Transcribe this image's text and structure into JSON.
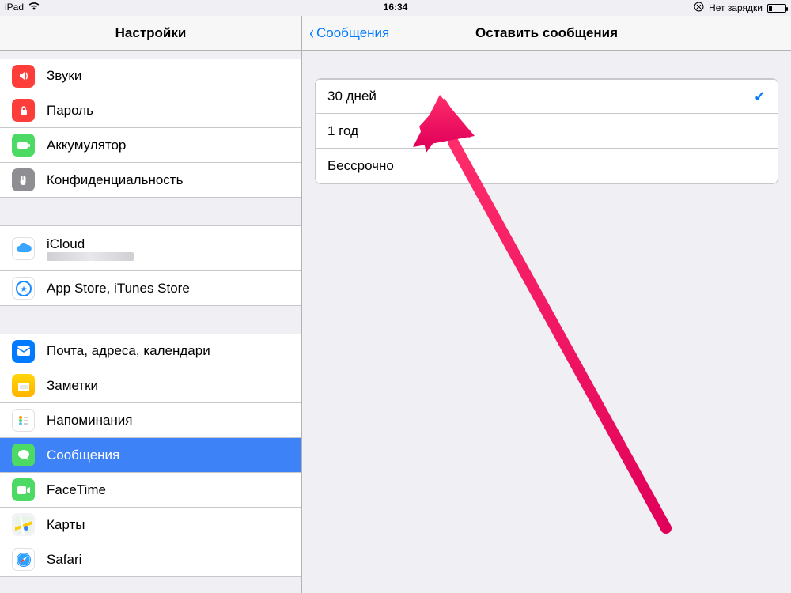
{
  "statusbar": {
    "device": "iPad",
    "time": "16:34",
    "charge_text": "Нет зарядки"
  },
  "sidebar": {
    "title": "Настройки",
    "group1": [
      {
        "id": "sounds",
        "label": "Звуки"
      },
      {
        "id": "passcode",
        "label": "Пароль"
      },
      {
        "id": "battery",
        "label": "Аккумулятор"
      },
      {
        "id": "privacy",
        "label": "Конфиденциальность"
      }
    ],
    "group2": [
      {
        "id": "icloud",
        "label": "iCloud",
        "sub": ""
      },
      {
        "id": "store",
        "label": "App Store, iTunes Store"
      }
    ],
    "group3": [
      {
        "id": "mail",
        "label": "Почта, адреса, календари"
      },
      {
        "id": "notes",
        "label": "Заметки"
      },
      {
        "id": "reminders",
        "label": "Напоминания"
      },
      {
        "id": "messages",
        "label": "Сообщения",
        "selected": true
      },
      {
        "id": "facetime",
        "label": "FaceTime"
      },
      {
        "id": "maps",
        "label": "Карты"
      },
      {
        "id": "safari",
        "label": "Safari"
      }
    ]
  },
  "detail": {
    "back_label": "Сообщения",
    "title": "Оставить сообщения",
    "options": [
      {
        "label": "30 дней",
        "checked": true
      },
      {
        "label": "1 год",
        "checked": false
      },
      {
        "label": "Бессрочно",
        "checked": false
      }
    ]
  },
  "annotation": {
    "arrow_color": "#ff2d6b"
  }
}
